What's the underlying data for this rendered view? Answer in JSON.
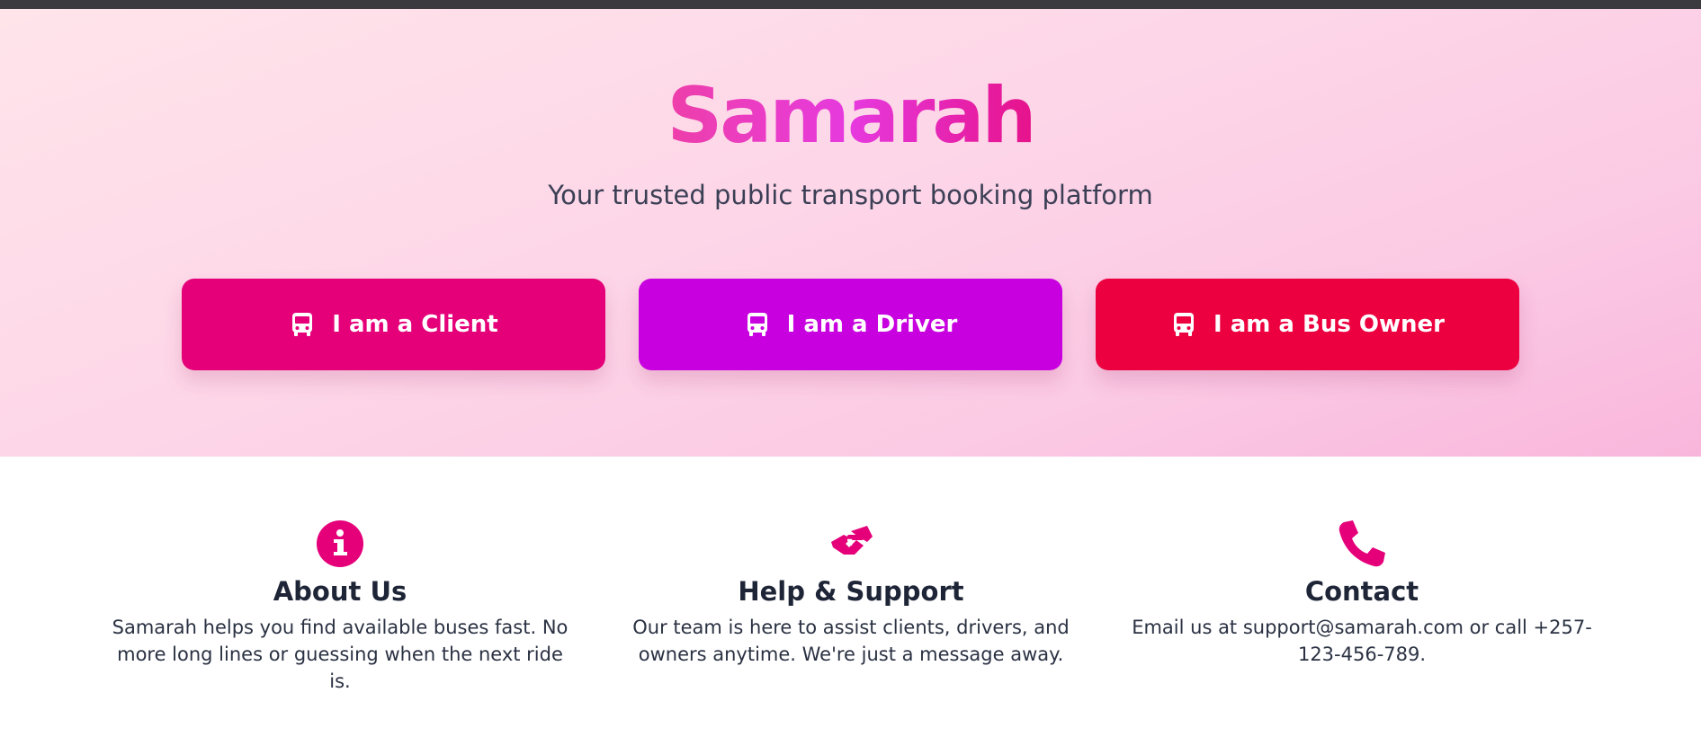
{
  "hero": {
    "brand": "Samarah",
    "tagline": "Your trusted public transport booking platform",
    "roles": [
      {
        "label": "I am a Client",
        "icon": "bus-icon",
        "color": "#e5007a"
      },
      {
        "label": "I am a Driver",
        "icon": "bus-icon",
        "color": "#c800e0"
      },
      {
        "label": "I am a Bus Owner",
        "icon": "bus-icon",
        "color": "#ec0040"
      }
    ]
  },
  "info": [
    {
      "icon": "info-circle-icon",
      "title": "About Us",
      "text": "Samarah helps you find available buses fast. No more long lines or guessing when the next ride is."
    },
    {
      "icon": "handshake-icon",
      "title": "Help & Support",
      "text": "Our team is here to assist clients, drivers, and owners anytime. We're just a message away."
    },
    {
      "icon": "phone-icon",
      "title": "Contact",
      "text": "Email us at support@samarah.com or call +257-123-456-789."
    }
  ],
  "colors": {
    "accent": "#e5007a",
    "heading": "#1e2537",
    "topbar": "#3b3b3f"
  }
}
